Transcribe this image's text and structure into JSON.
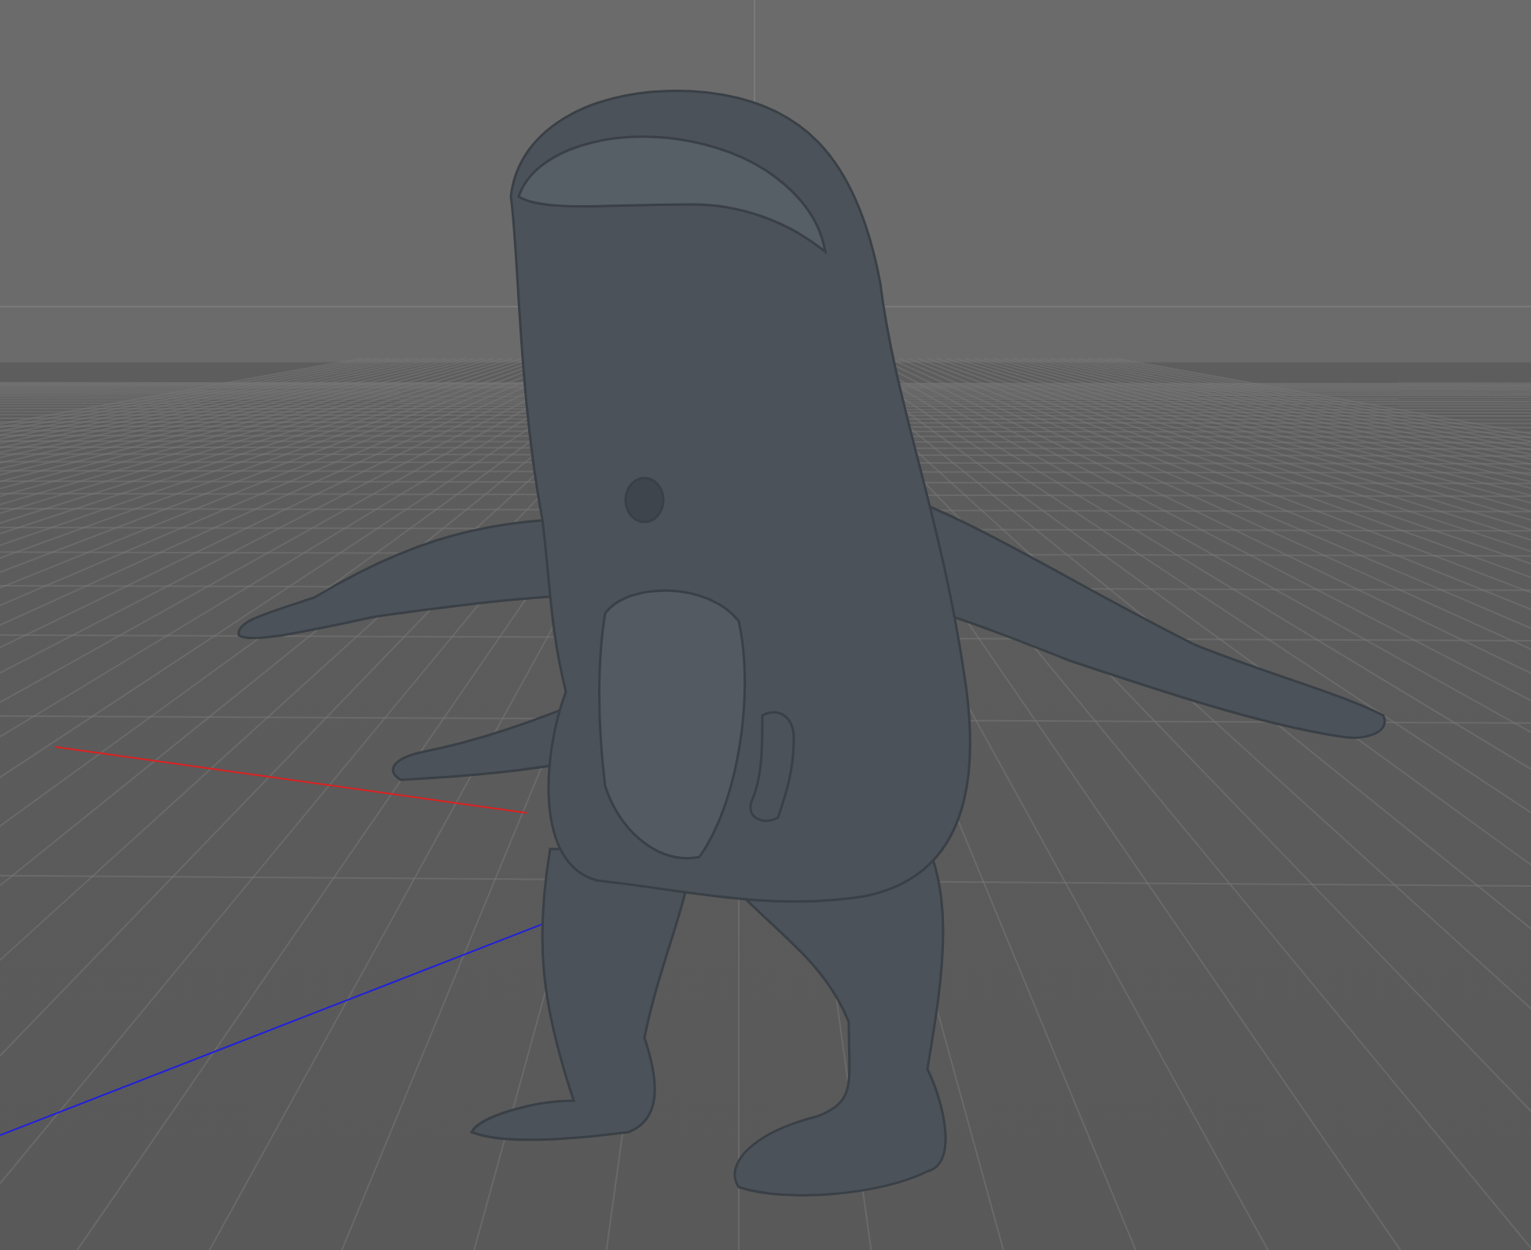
{
  "viewport": {
    "axes": [
      {
        "kind": "x",
        "color": "#e02020"
      },
      {
        "kind": "z",
        "color": "#2020e0"
      }
    ]
  }
}
